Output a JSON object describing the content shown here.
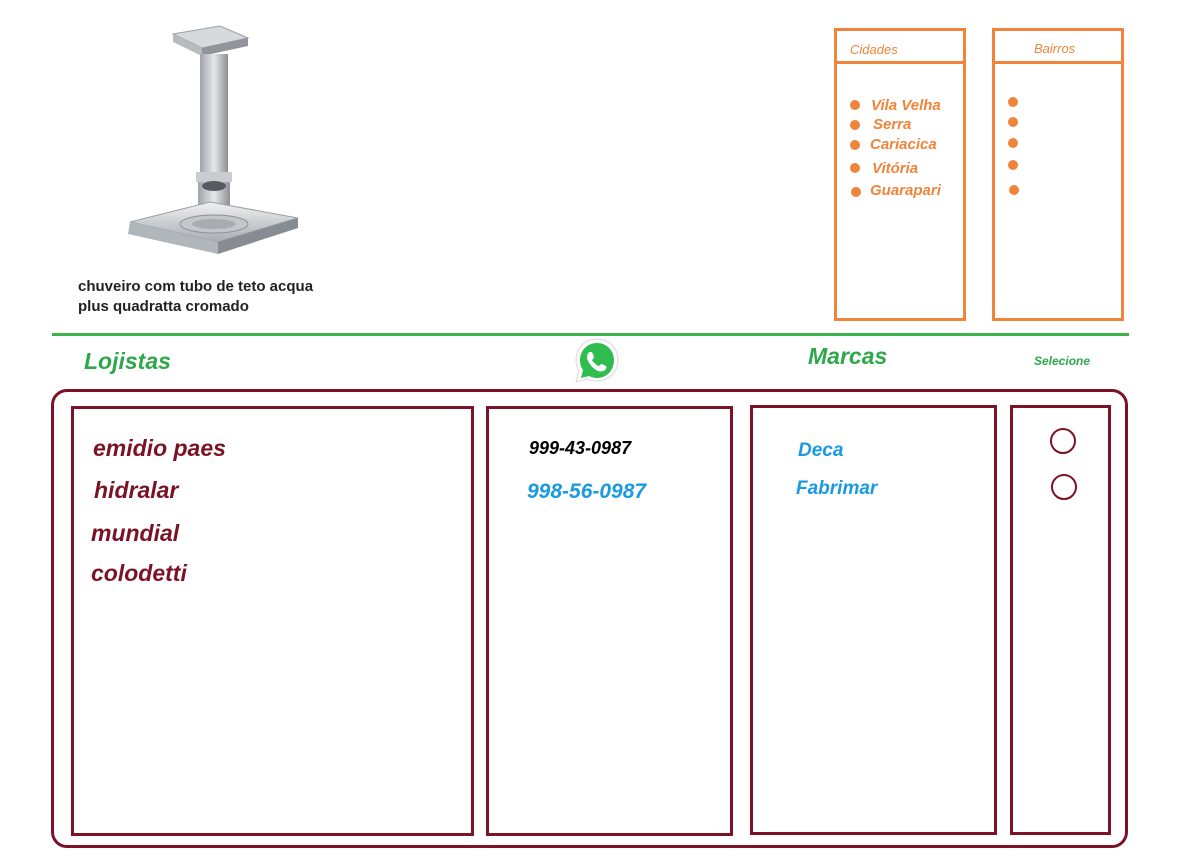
{
  "product": {
    "image_icon": "ceiling-shower-head",
    "caption_line1": "chuveiro com tubo de teto acqua",
    "caption_line2": "plus quadratta cromado"
  },
  "filters": {
    "cities": {
      "title": "Cidades",
      "items": [
        "Vila Velha",
        "Serra",
        "Cariacica",
        "Vitória",
        "Guarapari"
      ]
    },
    "neighborhoods": {
      "title": "Bairros",
      "items": [
        "",
        "",
        "",
        "",
        ""
      ]
    }
  },
  "sections": {
    "stores_heading": "Lojistas",
    "brands_heading": "Marcas",
    "select_heading": "Selecione",
    "contact_icon": "whatsapp-icon"
  },
  "stores": [
    "emidio paes",
    "hidralar",
    "mundial",
    "colodetti"
  ],
  "phones": [
    {
      "number": "999-43-0987",
      "color": "#000000"
    },
    {
      "number": "998-56-0987",
      "color": "#1a9ae0"
    }
  ],
  "brands": [
    "Deca",
    "Fabrimar"
  ],
  "colors": {
    "accent_orange": "#f0843a",
    "divider_green": "#3cb24a",
    "heading_green": "#2ea84a",
    "frame_maroon": "#7b1225",
    "brand_blue": "#1a9ae0"
  }
}
